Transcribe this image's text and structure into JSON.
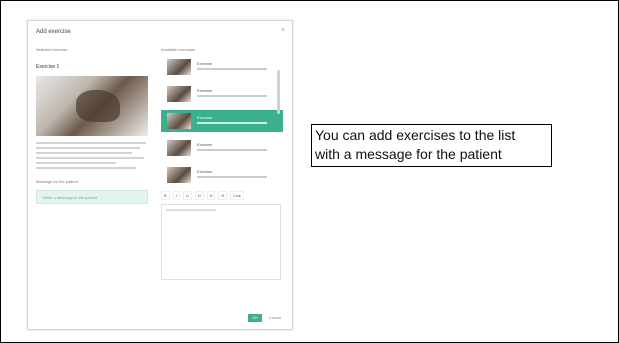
{
  "dialog": {
    "title": "Add exercise",
    "close": "×",
    "left_label": "Selected exercise",
    "exercise_name": "Exercise 1",
    "message_label": "Message for the patient",
    "message_value": "Write a message to the patient",
    "right_label": "Available exercises",
    "list": [
      {
        "title": "Exercise"
      },
      {
        "title": "Exercise"
      },
      {
        "title": "Exercise"
      },
      {
        "title": "Exercise"
      },
      {
        "title": "Exercise"
      }
    ],
    "toolbar": [
      "B",
      "I",
      "U",
      "H",
      "H",
      "H",
      "Link"
    ],
    "ok": "OK",
    "cancel": "Cancel"
  },
  "callout": {
    "line1": "You can add exercises to the list",
    "line2": "with a message for the patient"
  },
  "colors": {
    "accent": "#3bb08f"
  }
}
